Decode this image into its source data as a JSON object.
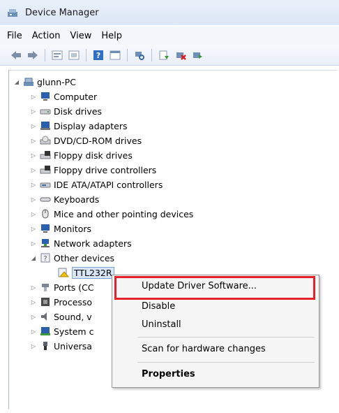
{
  "window": {
    "title": "Device Manager"
  },
  "menu": [
    "File",
    "Action",
    "View",
    "Help"
  ],
  "toolbar": {
    "buttons": [
      "back-icon",
      "forward-icon",
      "properties-view-icon",
      "list-icon",
      "help-icon",
      "console-icon",
      "scan-icon",
      "update-driver-icon",
      "uninstall-icon",
      "enable-icon"
    ]
  },
  "tree": {
    "root": "glunn-PC",
    "items": [
      "Computer",
      "Disk drives",
      "Display adapters",
      "DVD/CD-ROM drives",
      "Floppy disk drives",
      "Floppy drive controllers",
      "IDE ATA/ATAPI controllers",
      "Keyboards",
      "Mice and other pointing devices",
      "Monitors",
      "Network adapters",
      "Other devices",
      "TTL232R",
      "Ports (CC",
      "Processo",
      "Sound, v",
      "System c",
      "Universa"
    ]
  },
  "context_menu": {
    "items": [
      "Update Driver Software...",
      "Disable",
      "Uninstall",
      "Scan for hardware changes",
      "Properties"
    ]
  },
  "colors": {
    "highlight": "#e4212a",
    "titlebar": "#dce7f5"
  }
}
